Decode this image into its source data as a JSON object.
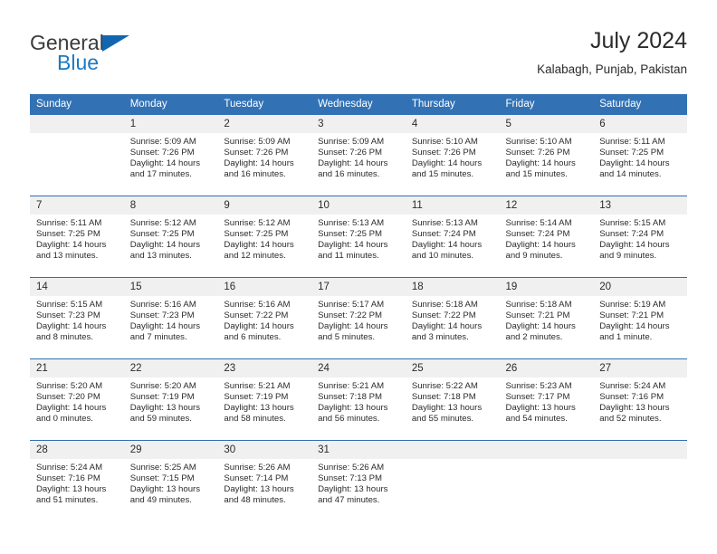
{
  "brand": {
    "name_part1": "General",
    "name_part2": "Blue",
    "triangle_color": "#1266b0",
    "blue_text_color": "#1a7ac4"
  },
  "header": {
    "title": "July 2024",
    "subtitle": "Kalabagh, Punjab, Pakistan",
    "accent_color": "#3272b4"
  },
  "weekday_headers": [
    "Sunday",
    "Monday",
    "Tuesday",
    "Wednesday",
    "Thursday",
    "Friday",
    "Saturday"
  ],
  "labels": {
    "sunrise_prefix": "Sunrise:",
    "sunset_prefix": "Sunset:",
    "daylight_prefix": "Daylight:"
  },
  "weeks": [
    [
      {
        "day": "",
        "sunrise": "",
        "sunset": "",
        "daylight_line1": "",
        "daylight_line2": ""
      },
      {
        "day": "1",
        "sunrise": "Sunrise: 5:09 AM",
        "sunset": "Sunset: 7:26 PM",
        "daylight_line1": "Daylight: 14 hours",
        "daylight_line2": "and 17 minutes."
      },
      {
        "day": "2",
        "sunrise": "Sunrise: 5:09 AM",
        "sunset": "Sunset: 7:26 PM",
        "daylight_line1": "Daylight: 14 hours",
        "daylight_line2": "and 16 minutes."
      },
      {
        "day": "3",
        "sunrise": "Sunrise: 5:09 AM",
        "sunset": "Sunset: 7:26 PM",
        "daylight_line1": "Daylight: 14 hours",
        "daylight_line2": "and 16 minutes."
      },
      {
        "day": "4",
        "sunrise": "Sunrise: 5:10 AM",
        "sunset": "Sunset: 7:26 PM",
        "daylight_line1": "Daylight: 14 hours",
        "daylight_line2": "and 15 minutes."
      },
      {
        "day": "5",
        "sunrise": "Sunrise: 5:10 AM",
        "sunset": "Sunset: 7:26 PM",
        "daylight_line1": "Daylight: 14 hours",
        "daylight_line2": "and 15 minutes."
      },
      {
        "day": "6",
        "sunrise": "Sunrise: 5:11 AM",
        "sunset": "Sunset: 7:25 PM",
        "daylight_line1": "Daylight: 14 hours",
        "daylight_line2": "and 14 minutes."
      }
    ],
    [
      {
        "day": "7",
        "sunrise": "Sunrise: 5:11 AM",
        "sunset": "Sunset: 7:25 PM",
        "daylight_line1": "Daylight: 14 hours",
        "daylight_line2": "and 13 minutes."
      },
      {
        "day": "8",
        "sunrise": "Sunrise: 5:12 AM",
        "sunset": "Sunset: 7:25 PM",
        "daylight_line1": "Daylight: 14 hours",
        "daylight_line2": "and 13 minutes."
      },
      {
        "day": "9",
        "sunrise": "Sunrise: 5:12 AM",
        "sunset": "Sunset: 7:25 PM",
        "daylight_line1": "Daylight: 14 hours",
        "daylight_line2": "and 12 minutes."
      },
      {
        "day": "10",
        "sunrise": "Sunrise: 5:13 AM",
        "sunset": "Sunset: 7:25 PM",
        "daylight_line1": "Daylight: 14 hours",
        "daylight_line2": "and 11 minutes."
      },
      {
        "day": "11",
        "sunrise": "Sunrise: 5:13 AM",
        "sunset": "Sunset: 7:24 PM",
        "daylight_line1": "Daylight: 14 hours",
        "daylight_line2": "and 10 minutes."
      },
      {
        "day": "12",
        "sunrise": "Sunrise: 5:14 AM",
        "sunset": "Sunset: 7:24 PM",
        "daylight_line1": "Daylight: 14 hours",
        "daylight_line2": "and 9 minutes."
      },
      {
        "day": "13",
        "sunrise": "Sunrise: 5:15 AM",
        "sunset": "Sunset: 7:24 PM",
        "daylight_line1": "Daylight: 14 hours",
        "daylight_line2": "and 9 minutes."
      }
    ],
    [
      {
        "day": "14",
        "sunrise": "Sunrise: 5:15 AM",
        "sunset": "Sunset: 7:23 PM",
        "daylight_line1": "Daylight: 14 hours",
        "daylight_line2": "and 8 minutes."
      },
      {
        "day": "15",
        "sunrise": "Sunrise: 5:16 AM",
        "sunset": "Sunset: 7:23 PM",
        "daylight_line1": "Daylight: 14 hours",
        "daylight_line2": "and 7 minutes."
      },
      {
        "day": "16",
        "sunrise": "Sunrise: 5:16 AM",
        "sunset": "Sunset: 7:22 PM",
        "daylight_line1": "Daylight: 14 hours",
        "daylight_line2": "and 6 minutes."
      },
      {
        "day": "17",
        "sunrise": "Sunrise: 5:17 AM",
        "sunset": "Sunset: 7:22 PM",
        "daylight_line1": "Daylight: 14 hours",
        "daylight_line2": "and 5 minutes."
      },
      {
        "day": "18",
        "sunrise": "Sunrise: 5:18 AM",
        "sunset": "Sunset: 7:22 PM",
        "daylight_line1": "Daylight: 14 hours",
        "daylight_line2": "and 3 minutes."
      },
      {
        "day": "19",
        "sunrise": "Sunrise: 5:18 AM",
        "sunset": "Sunset: 7:21 PM",
        "daylight_line1": "Daylight: 14 hours",
        "daylight_line2": "and 2 minutes."
      },
      {
        "day": "20",
        "sunrise": "Sunrise: 5:19 AM",
        "sunset": "Sunset: 7:21 PM",
        "daylight_line1": "Daylight: 14 hours",
        "daylight_line2": "and 1 minute."
      }
    ],
    [
      {
        "day": "21",
        "sunrise": "Sunrise: 5:20 AM",
        "sunset": "Sunset: 7:20 PM",
        "daylight_line1": "Daylight: 14 hours",
        "daylight_line2": "and 0 minutes."
      },
      {
        "day": "22",
        "sunrise": "Sunrise: 5:20 AM",
        "sunset": "Sunset: 7:19 PM",
        "daylight_line1": "Daylight: 13 hours",
        "daylight_line2": "and 59 minutes."
      },
      {
        "day": "23",
        "sunrise": "Sunrise: 5:21 AM",
        "sunset": "Sunset: 7:19 PM",
        "daylight_line1": "Daylight: 13 hours",
        "daylight_line2": "and 58 minutes."
      },
      {
        "day": "24",
        "sunrise": "Sunrise: 5:21 AM",
        "sunset": "Sunset: 7:18 PM",
        "daylight_line1": "Daylight: 13 hours",
        "daylight_line2": "and 56 minutes."
      },
      {
        "day": "25",
        "sunrise": "Sunrise: 5:22 AM",
        "sunset": "Sunset: 7:18 PM",
        "daylight_line1": "Daylight: 13 hours",
        "daylight_line2": "and 55 minutes."
      },
      {
        "day": "26",
        "sunrise": "Sunrise: 5:23 AM",
        "sunset": "Sunset: 7:17 PM",
        "daylight_line1": "Daylight: 13 hours",
        "daylight_line2": "and 54 minutes."
      },
      {
        "day": "27",
        "sunrise": "Sunrise: 5:24 AM",
        "sunset": "Sunset: 7:16 PM",
        "daylight_line1": "Daylight: 13 hours",
        "daylight_line2": "and 52 minutes."
      }
    ],
    [
      {
        "day": "28",
        "sunrise": "Sunrise: 5:24 AM",
        "sunset": "Sunset: 7:16 PM",
        "daylight_line1": "Daylight: 13 hours",
        "daylight_line2": "and 51 minutes."
      },
      {
        "day": "29",
        "sunrise": "Sunrise: 5:25 AM",
        "sunset": "Sunset: 7:15 PM",
        "daylight_line1": "Daylight: 13 hours",
        "daylight_line2": "and 49 minutes."
      },
      {
        "day": "30",
        "sunrise": "Sunrise: 5:26 AM",
        "sunset": "Sunset: 7:14 PM",
        "daylight_line1": "Daylight: 13 hours",
        "daylight_line2": "and 48 minutes."
      },
      {
        "day": "31",
        "sunrise": "Sunrise: 5:26 AM",
        "sunset": "Sunset: 7:13 PM",
        "daylight_line1": "Daylight: 13 hours",
        "daylight_line2": "and 47 minutes."
      },
      {
        "day": "",
        "sunrise": "",
        "sunset": "",
        "daylight_line1": "",
        "daylight_line2": ""
      },
      {
        "day": "",
        "sunrise": "",
        "sunset": "",
        "daylight_line1": "",
        "daylight_line2": ""
      },
      {
        "day": "",
        "sunrise": "",
        "sunset": "",
        "daylight_line1": "",
        "daylight_line2": ""
      }
    ]
  ]
}
